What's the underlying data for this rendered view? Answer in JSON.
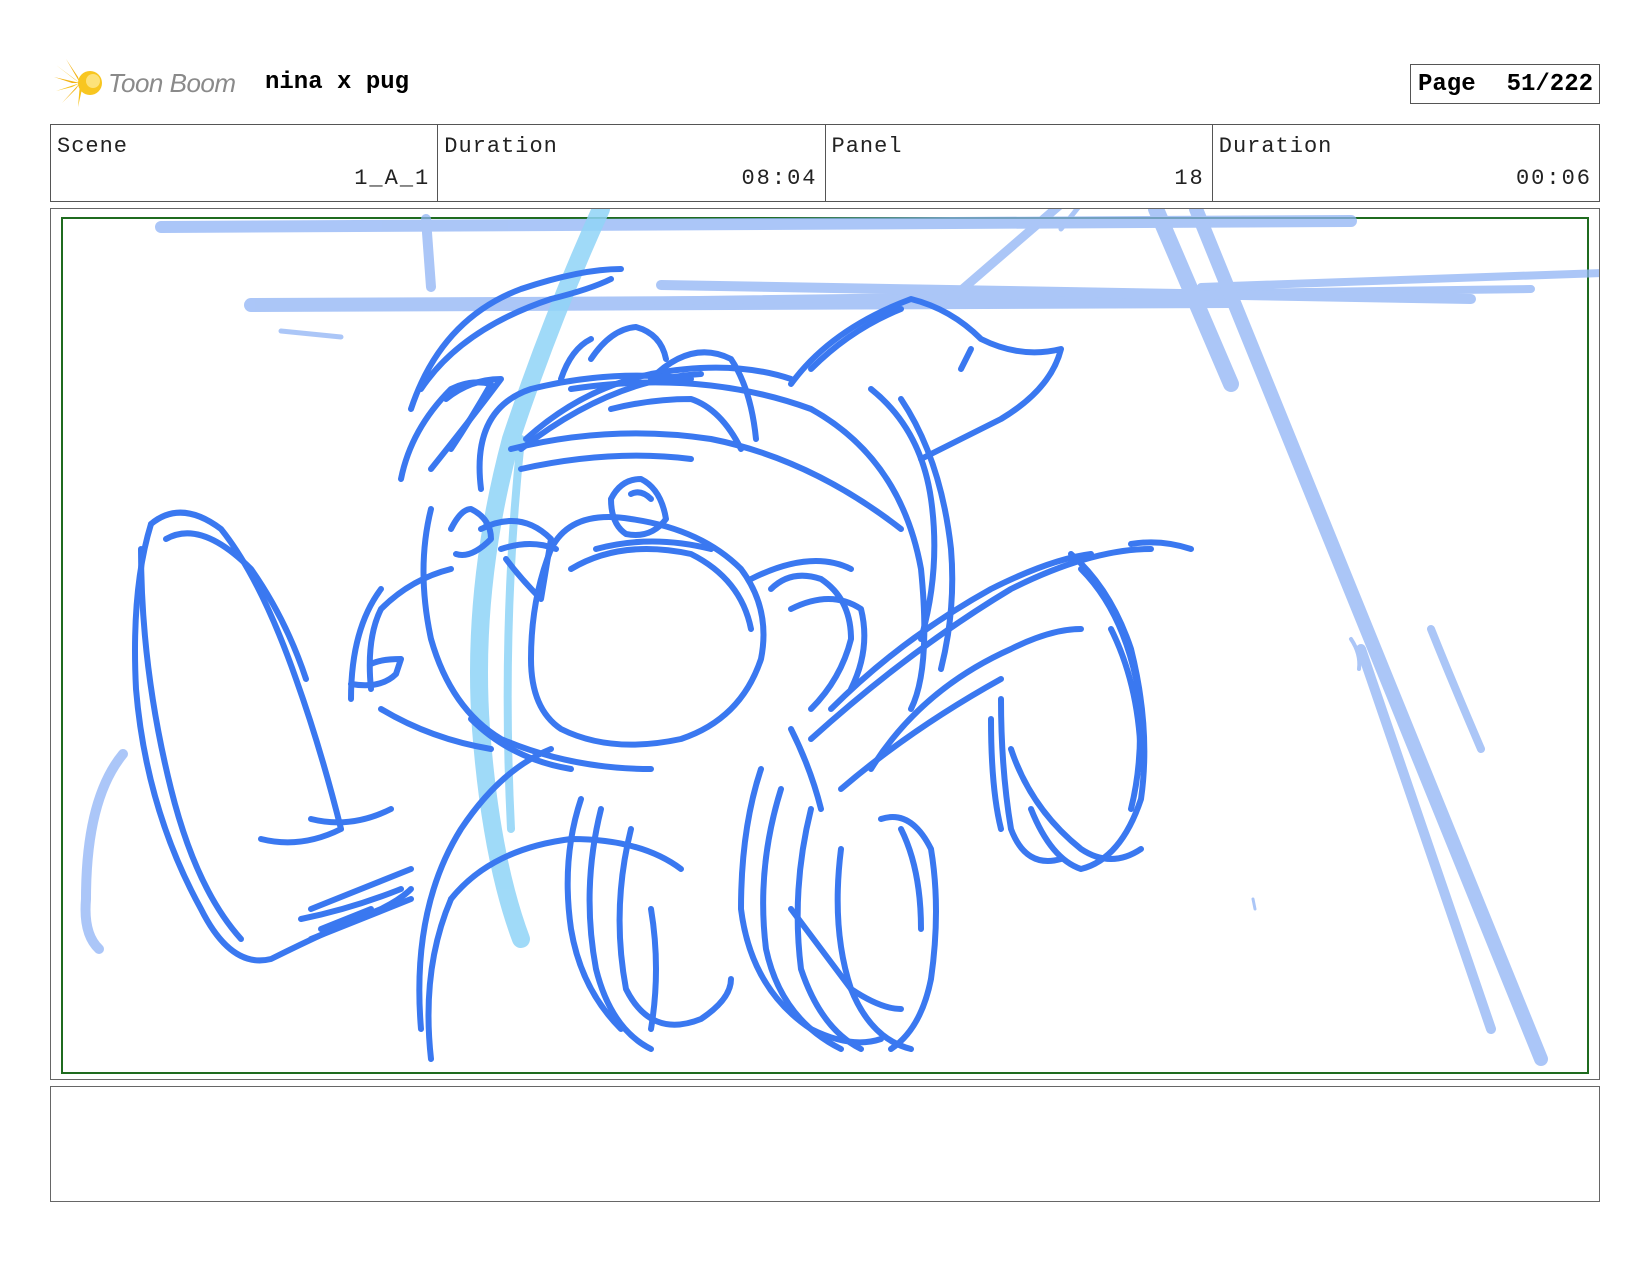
{
  "header": {
    "logo_text": "Toon Boom",
    "project_title": "nina x pug",
    "page_label": "Page",
    "page_value": "51/222"
  },
  "info": {
    "scene_label": "Scene",
    "scene_value": "1_A_1",
    "scene_duration_label": "Duration",
    "scene_duration_value": "08:04",
    "panel_label": "Panel",
    "panel_value": "18",
    "panel_duration_label": "Duration",
    "panel_duration_value": "00:06"
  },
  "panel": {
    "sketch_color": "#3a78f0",
    "light_stroke_color": "#8fb3f5",
    "motion_line_color": "#8fd4f7",
    "safe_frame_color": "#1f6b1f"
  },
  "notes": {
    "text": ""
  }
}
